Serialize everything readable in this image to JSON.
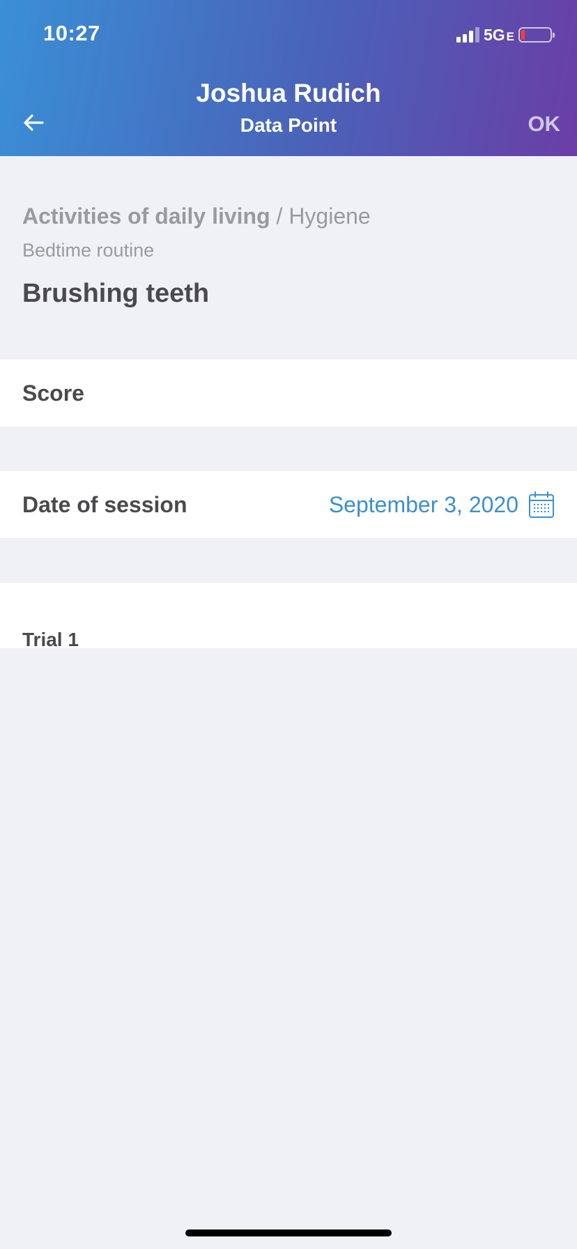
{
  "status_bar": {
    "time": "10:27",
    "network": "5G",
    "network_suffix": "E",
    "battery_color": "#ff3b30"
  },
  "header": {
    "title": "Joshua Rudich",
    "subtitle": "Data Point",
    "back_icon": "arrow-left-icon",
    "ok_label": "OK"
  },
  "breadcrumb": {
    "category": "Activities of daily living",
    "separator": " / ",
    "subcategory": "Hygiene",
    "routine": "Bedtime routine",
    "item": "Brushing teeth"
  },
  "rows": {
    "score_label": "Score",
    "date_label": "Date of session",
    "date_value": "September 3, 2020",
    "date_icon": "calendar-icon",
    "trial_label": "Trial 1"
  },
  "colors": {
    "accent": "#3b8fd0",
    "header_start": "#3a8fd6",
    "header_end": "#6a3ea6"
  }
}
